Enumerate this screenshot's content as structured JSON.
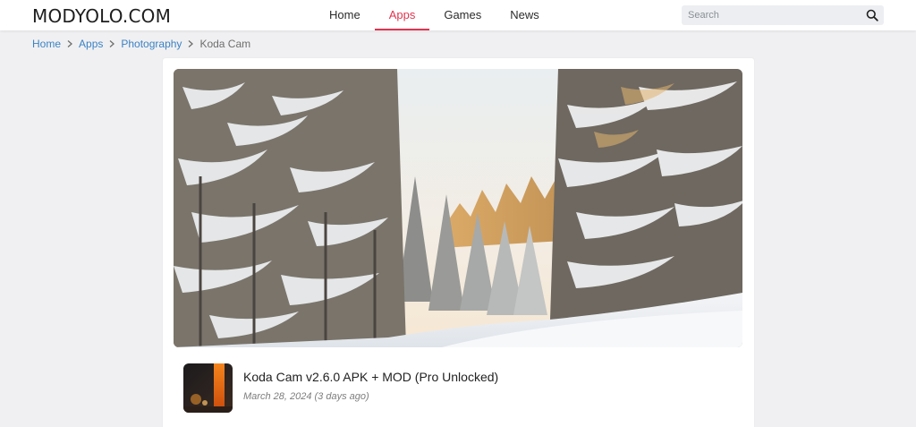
{
  "site": {
    "logo": "MODYOLO.COM"
  },
  "nav": {
    "items": [
      {
        "label": "Home"
      },
      {
        "label": "Apps"
      },
      {
        "label": "Games"
      },
      {
        "label": "News"
      }
    ],
    "active": "Apps"
  },
  "search": {
    "placeholder": "Search",
    "icon": "search-icon"
  },
  "breadcrumb": {
    "items": [
      {
        "label": "Home"
      },
      {
        "label": "Apps"
      },
      {
        "label": "Photography"
      }
    ],
    "current": "Koda Cam",
    "separator_icon": "chevron-right-icon"
  },
  "post": {
    "title": "Koda Cam v2.6.0 APK + MOD (Pro Unlocked)",
    "date": "March 28, 2024 (3 days ago)"
  },
  "colors": {
    "accent": "#e0344f",
    "link": "#3b82c4",
    "page_background": "#f0f0f2"
  }
}
